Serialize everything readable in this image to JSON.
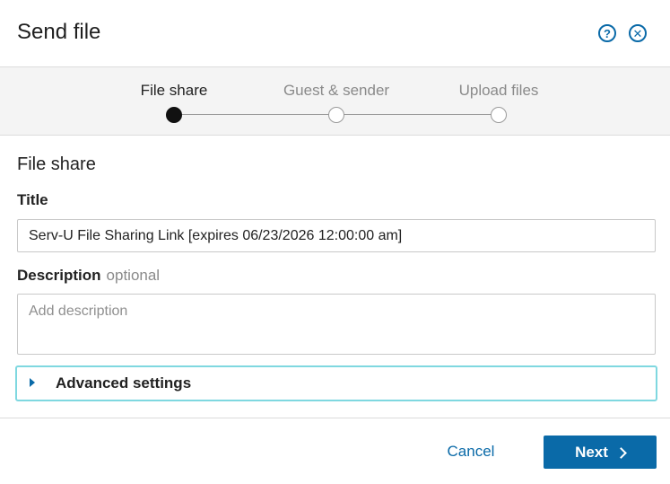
{
  "dialog": {
    "title": "Send file",
    "help_icon_glyph": "?",
    "close_icon_glyph": "✕"
  },
  "steps": [
    {
      "label": "File share",
      "state": "active"
    },
    {
      "label": "Guest & sender",
      "state": "pending"
    },
    {
      "label": "Upload files",
      "state": "pending"
    }
  ],
  "form": {
    "section_title": "File share",
    "title_label": "Title",
    "title_value": "Serv-U File Sharing Link [expires 06/23/2026 12:00:00 am]",
    "description_label": "Description",
    "description_optional": "optional",
    "description_placeholder": "Add description",
    "advanced_label": "Advanced settings"
  },
  "footer": {
    "cancel_label": "Cancel",
    "next_label": "Next"
  },
  "colors": {
    "accent": "#0a6aa8",
    "focus_border": "#7fd8e0"
  },
  "icons": [
    "help-icon",
    "close-icon",
    "caret-right-icon",
    "chevron-right-icon"
  ]
}
